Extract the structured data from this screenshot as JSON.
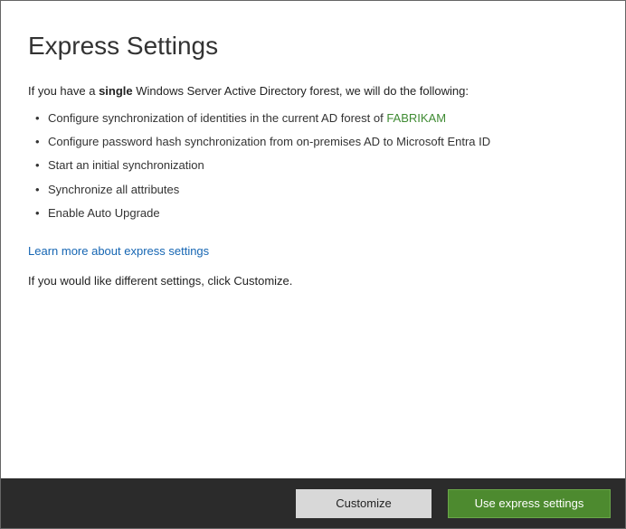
{
  "page": {
    "title": "Express Settings",
    "intro_prefix": "If you have a ",
    "intro_bold": "single",
    "intro_suffix": " Windows Server Active Directory forest, we will do the following:",
    "learn_more": "Learn more about express settings",
    "customize_note": "If you would like different settings, click Customize."
  },
  "bullets": {
    "item1_prefix": "Configure synchronization of identities in the current AD forest of ",
    "item1_forest": "FABRIKAM",
    "item2": "Configure password hash synchronization from on-premises AD to Microsoft Entra ID",
    "item3": "Start an initial synchronization",
    "item4": "Synchronize all attributes",
    "item5": "Enable Auto Upgrade"
  },
  "footer": {
    "customize_label": "Customize",
    "express_label": "Use express settings"
  }
}
